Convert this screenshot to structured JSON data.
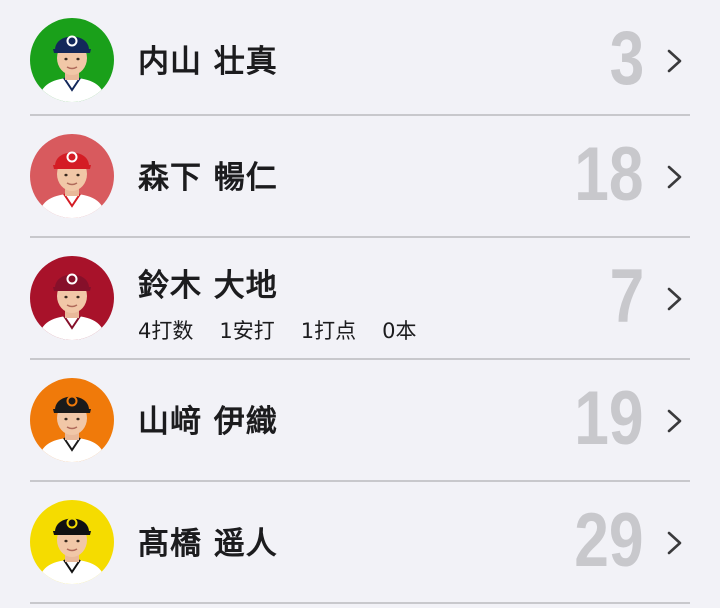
{
  "players": [
    {
      "name": "内山 壮真",
      "number": "3",
      "avatar_bg": "#1aa01a",
      "cap_color": "#13285a",
      "cap_mark_color": "#ffffff",
      "uniform_color": "#ffffff",
      "stats": []
    },
    {
      "name": "森下 暢仁",
      "number": "18",
      "avatar_bg": "#d85a5e",
      "cap_color": "#d41c24",
      "cap_mark_color": "#ffffff",
      "uniform_color": "#ffffff",
      "stats": []
    },
    {
      "name": "鈴木 大地",
      "number": "7",
      "avatar_bg": "#a8122a",
      "cap_color": "#86102a",
      "cap_mark_color": "#ffffff",
      "uniform_color": "#ffffff",
      "stats": [
        "4打数",
        "1安打",
        "1打点",
        "0本"
      ]
    },
    {
      "name": "山﨑 伊織",
      "number": "19",
      "avatar_bg": "#f07a0a",
      "cap_color": "#1a1a1a",
      "cap_mark_color": "#f07a0a",
      "uniform_color": "#ffffff",
      "stats": []
    },
    {
      "name": "髙橋 遥人",
      "number": "29",
      "avatar_bg": "#f5dc00",
      "cap_color": "#111111",
      "cap_mark_color": "#f5dc00",
      "uniform_color": "#ffffff",
      "stats": []
    }
  ],
  "icons": {
    "chevron": "chevron-right-icon",
    "avatar": "player-photo"
  }
}
